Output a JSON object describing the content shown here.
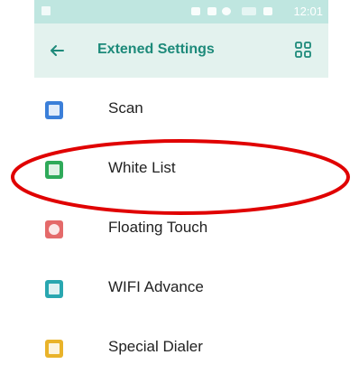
{
  "status_bar": {
    "time": "12:01"
  },
  "header": {
    "title": "Extened Settings",
    "back_icon": "arrow-left-icon",
    "menu_icon": "grid-icon"
  },
  "colors": {
    "accent": "#1d8a7a",
    "header_bg": "#e3f2ee",
    "status_bg": "#bfe6e0",
    "highlight": "#e00000"
  },
  "items": [
    {
      "label": "Scan",
      "icon": "scan-icon",
      "color": "#3b7fd9"
    },
    {
      "label": "White List",
      "icon": "white-list-icon",
      "color": "#2faa5a"
    },
    {
      "label": "Floating Touch",
      "icon": "floating-touch-icon",
      "color": "#e46a6a"
    },
    {
      "label": "WIFI Advance",
      "icon": "wifi-advance-icon",
      "color": "#29a7b0"
    },
    {
      "label": "Special Dialer",
      "icon": "special-dialer-icon",
      "color": "#e9b32a"
    }
  ]
}
